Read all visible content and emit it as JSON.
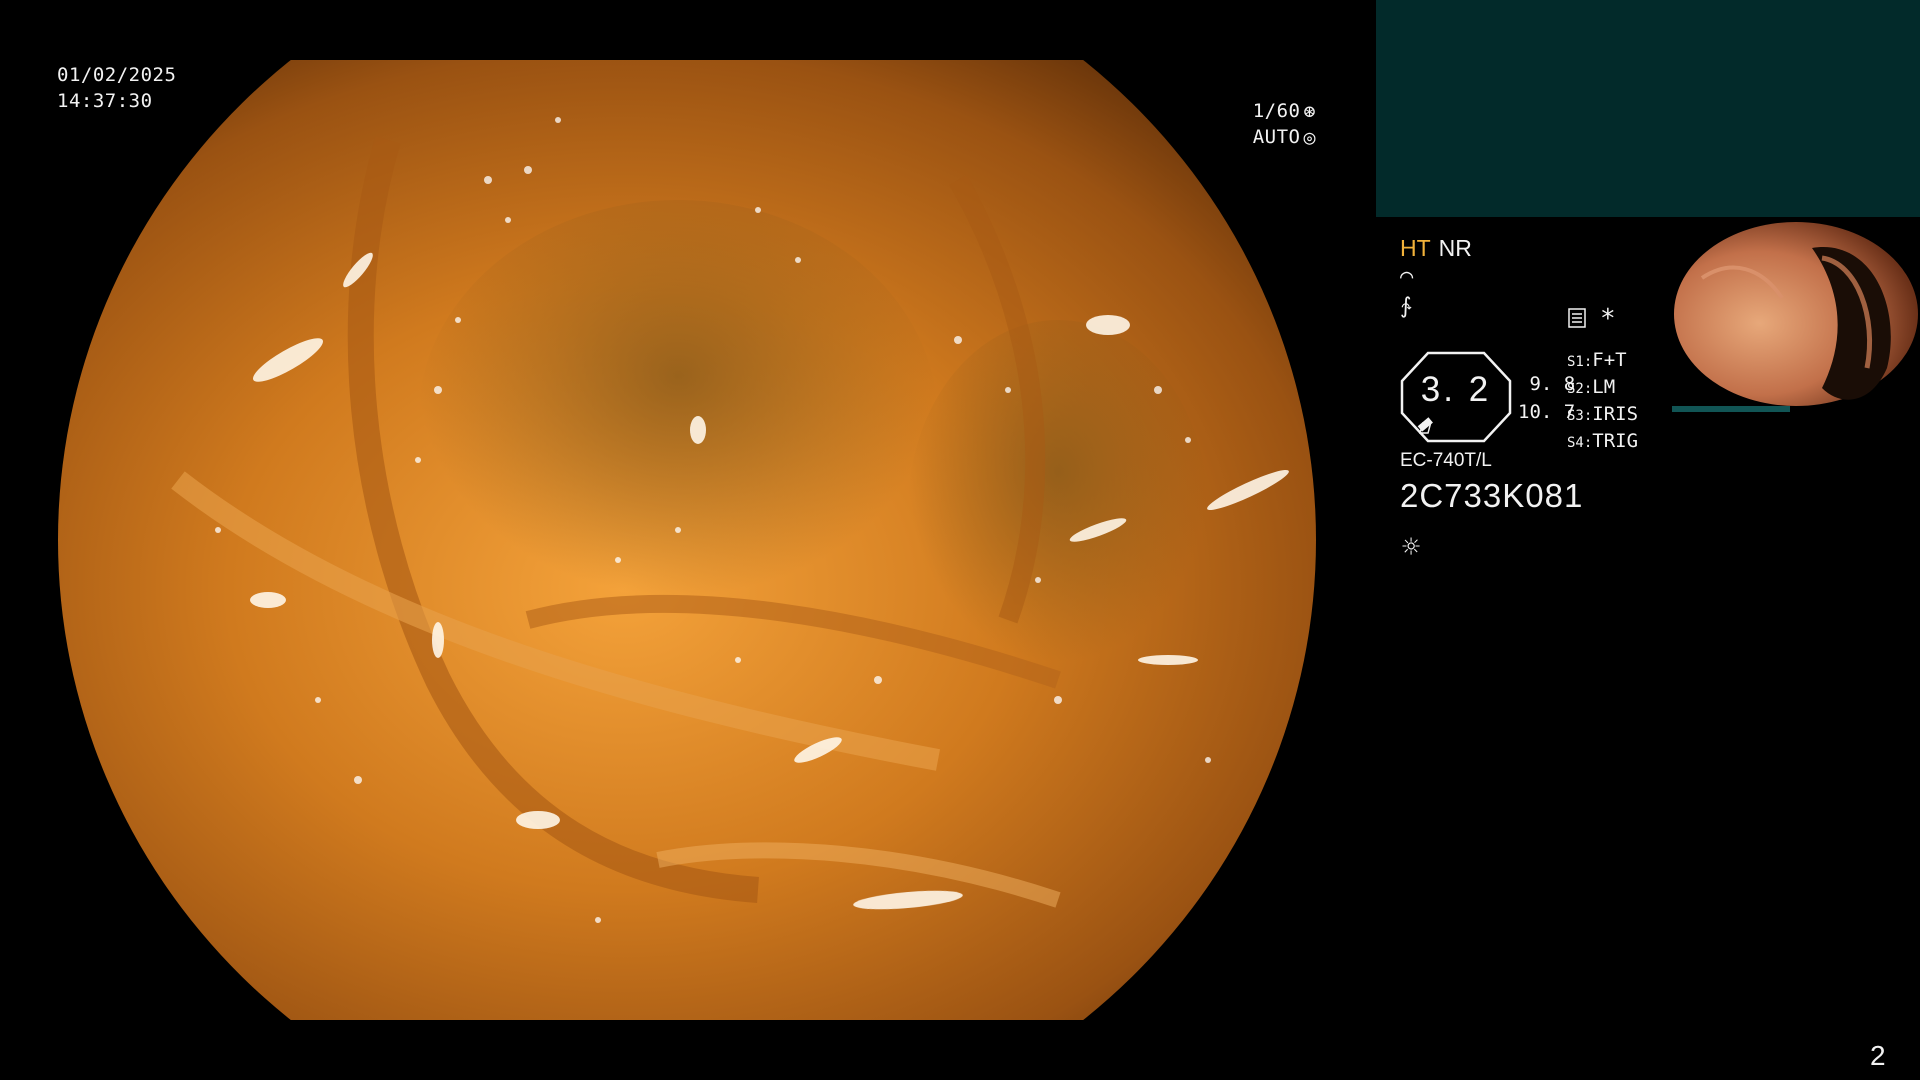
{
  "overlay": {
    "date": "01/02/2025",
    "time": "14:37:30",
    "shutter": "1/60",
    "iris": "AUTO",
    "page_number": "2"
  },
  "mode": {
    "ht": "HT",
    "nr": "NR"
  },
  "zoom": {
    "value": "3. 2",
    "side_top": "9. 8",
    "side_bottom": "10. 7"
  },
  "switches": [
    {
      "key": "S1:",
      "value": "F+T"
    },
    {
      "key": "S2:",
      "value": "LM"
    },
    {
      "key": "S3:",
      "value": "IRIS"
    },
    {
      "key": "S4:",
      "value": "TRIG"
    }
  ],
  "scope": {
    "model": "EC-740T/L",
    "serial": "2C733K081"
  },
  "icons": {
    "shutter_icon": "aperture-icon",
    "iris_icon": "iris-icon",
    "wave_icon": "structure-enhance-icon",
    "freq_icon": "color-enhance-icon",
    "menu_icon": "list-icon",
    "asterisk": "*",
    "light_icon": "light-source-icon"
  },
  "colors": {
    "background": "#000000",
    "ht_accent": "#f2b23a",
    "panel_teal": "#022a2a"
  }
}
